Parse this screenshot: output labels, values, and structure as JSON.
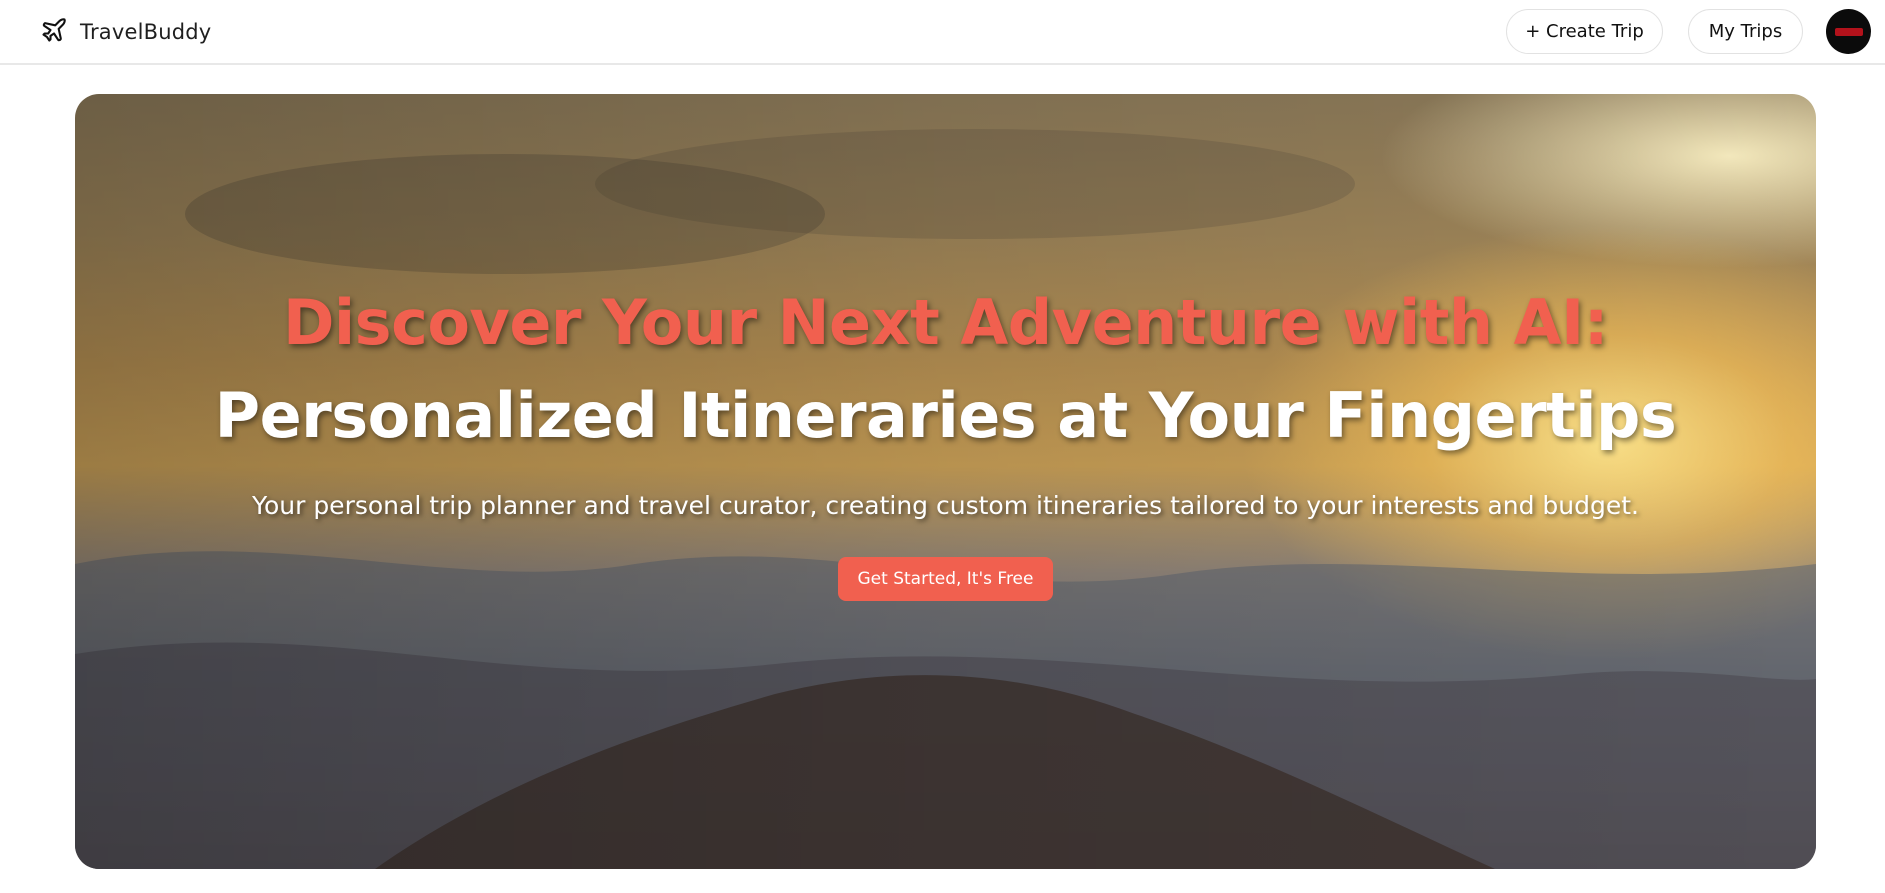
{
  "header": {
    "brand_icon": "airplane-icon",
    "brand_name": "TravelBuddy",
    "create_trip_label": "+ Create Trip",
    "my_trips_label": "My Trips"
  },
  "hero": {
    "title_accent": "Discover Your Next Adventure with AI:",
    "title_rest": "Personalized Itineraries at Your Fingertips",
    "subtitle": "Your personal trip planner and travel curator, creating custom itineraries tailored to your interests and budget.",
    "cta_label": "Get Started, It's Free"
  },
  "colors": {
    "accent": "#f1604f",
    "text_dark": "#111111"
  }
}
